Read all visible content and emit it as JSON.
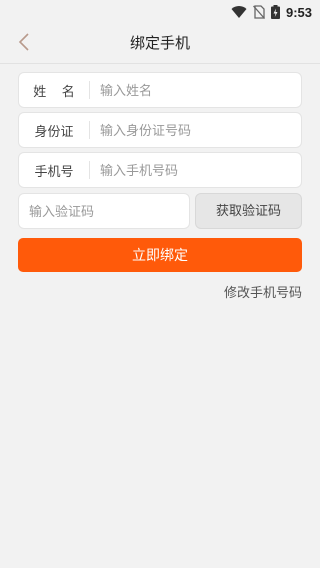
{
  "status_bar": {
    "time": "9:53",
    "icons": [
      "wifi-icon",
      "no-sim-icon",
      "battery-charging-icon"
    ]
  },
  "header": {
    "title": "绑定手机",
    "back_icon": "chevron-left-icon",
    "back_icon_color": "#c0a090"
  },
  "form": {
    "name": {
      "label": "姓 名",
      "placeholder": "输入姓名",
      "value": ""
    },
    "id_card": {
      "label": "身份证",
      "placeholder": "输入身份证号码",
      "value": ""
    },
    "phone": {
      "label": "手机号",
      "placeholder": "输入手机号码",
      "value": ""
    },
    "code": {
      "placeholder": "输入验证码",
      "value": ""
    },
    "get_code_label": "获取验证码",
    "submit_label": "立即绑定",
    "change_phone_label": "修改手机号码"
  },
  "colors": {
    "accent": "#ff5a0a",
    "background": "#f2f2f2"
  }
}
